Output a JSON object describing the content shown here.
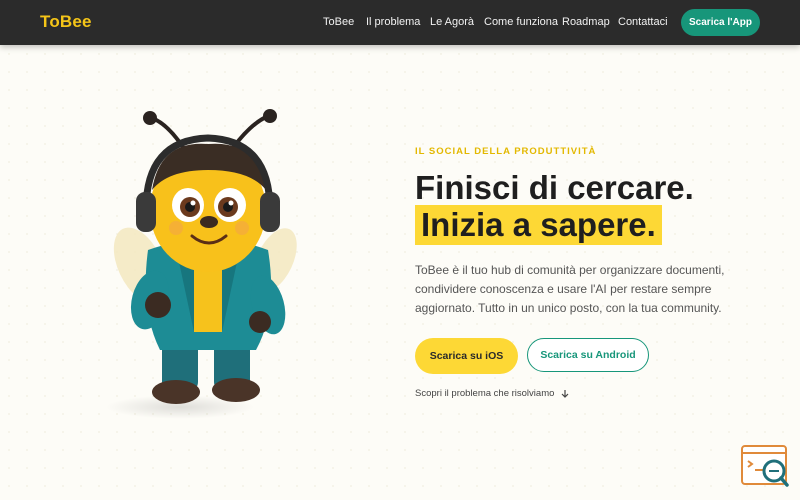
{
  "header": {
    "logo": "ToBee",
    "nav": [
      "ToBee",
      "Il problema",
      "Le Agorà",
      "Come funziona",
      "Roadmap",
      "Contattaci"
    ],
    "cta": "Scarica l'App"
  },
  "hero": {
    "eyebrow": "IL SOCIAL DELLA PRODUTTIVITÀ",
    "title_line1": "Finisci di cercare.",
    "title_line2": "Inizia a sapere.",
    "description": "ToBee è il tuo hub di comunità per organizzare documenti, condividere conoscenza e usare l'AI per restare sempre aggiornato. Tutto in un unico posto, con la tua community.",
    "button_ios": "Scarica su iOS",
    "button_android": "Scarica su Android",
    "discover_link": "Scopri il problema che risolviamo"
  },
  "icons": {
    "mascot": "bee-mascot-illustration",
    "discover_arrow": "arrow-down-icon",
    "corner_widget": "search-widget-icon"
  },
  "colors": {
    "accent_yellow": "#fdd835",
    "accent_green": "#17967a",
    "header_bg": "#2b2b2b",
    "logo": "#f5c518"
  }
}
